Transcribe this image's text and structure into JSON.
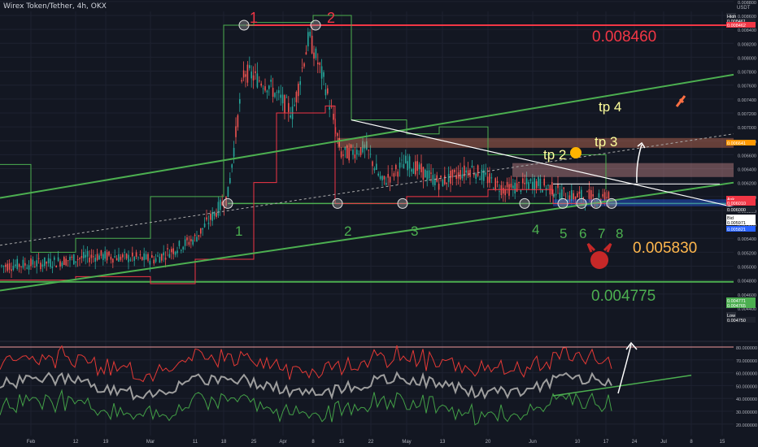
{
  "header": {
    "title": "Wirex Token/Tether, 4h, OKX",
    "currency": "USDT"
  },
  "colors": {
    "background": "#131722",
    "grid": "#1e2230",
    "up": "#26a69a",
    "down": "#ef5350",
    "green_line": "#4caf50",
    "red_line": "#f23645",
    "white_line": "#ffffff",
    "orange_text": "#ffb74d"
  },
  "chart_data": {
    "type": "candlestick",
    "price_axis_ticks": [
      "0.008800",
      "0.008600",
      "0.008400",
      "0.008200",
      "0.008000",
      "0.007800",
      "0.007600",
      "0.007400",
      "0.007200",
      "0.007000",
      "0.006800",
      "0.006600",
      "0.006400",
      "0.006200",
      "0.006000",
      "0.005800",
      "0.005600",
      "0.005400",
      "0.005200",
      "0.005000",
      "0.004800",
      "0.004600",
      "0.004400"
    ],
    "price_labels": [
      {
        "text": "High",
        "kind": "tag"
      },
      {
        "text": "0.008461",
        "kind": "plain"
      },
      {
        "text": "0.008462",
        "kind": "red"
      },
      {
        "text": "0.006641",
        "kind": "orange"
      },
      {
        "text": "Ask",
        "kind": "red"
      },
      {
        "text": "0.006010",
        "kind": "red"
      },
      {
        "text": "0.006000",
        "kind": "plain"
      },
      {
        "text": "Bid",
        "kind": "white"
      },
      {
        "text": "0.005971",
        "kind": "white"
      },
      {
        "text": "0.005821",
        "kind": "blue"
      },
      {
        "text": "0.004771",
        "kind": "green"
      },
      {
        "text": "0.004765",
        "kind": "green"
      },
      {
        "text": "Low",
        "kind": "tag"
      },
      {
        "text": "0.004750",
        "kind": "plain"
      }
    ],
    "osc_ticks": [
      "80.000000",
      "70.000000",
      "60.000000",
      "50.000000",
      "40.000000",
      "30.000000",
      "20.000000"
    ],
    "time_ticks": [
      "Feb",
      "12",
      "19",
      "Mar",
      "11",
      "18",
      "25",
      "Apr",
      "8",
      "15",
      "22",
      "May",
      "13",
      "20",
      "Jun",
      "10",
      "17",
      "24",
      "Jul",
      "8",
      "15"
    ],
    "levels": {
      "top_red": "0.008460",
      "support_red": "0.005830",
      "bottom_green": "0.004775"
    },
    "targets": [
      "tp 4",
      "tp 3",
      "tp 2"
    ],
    "touch_labels_top": [
      "1",
      "2"
    ],
    "touch_labels_bottom": [
      "1",
      "2",
      "3",
      "4",
      "5",
      "6",
      "7",
      "8"
    ]
  }
}
